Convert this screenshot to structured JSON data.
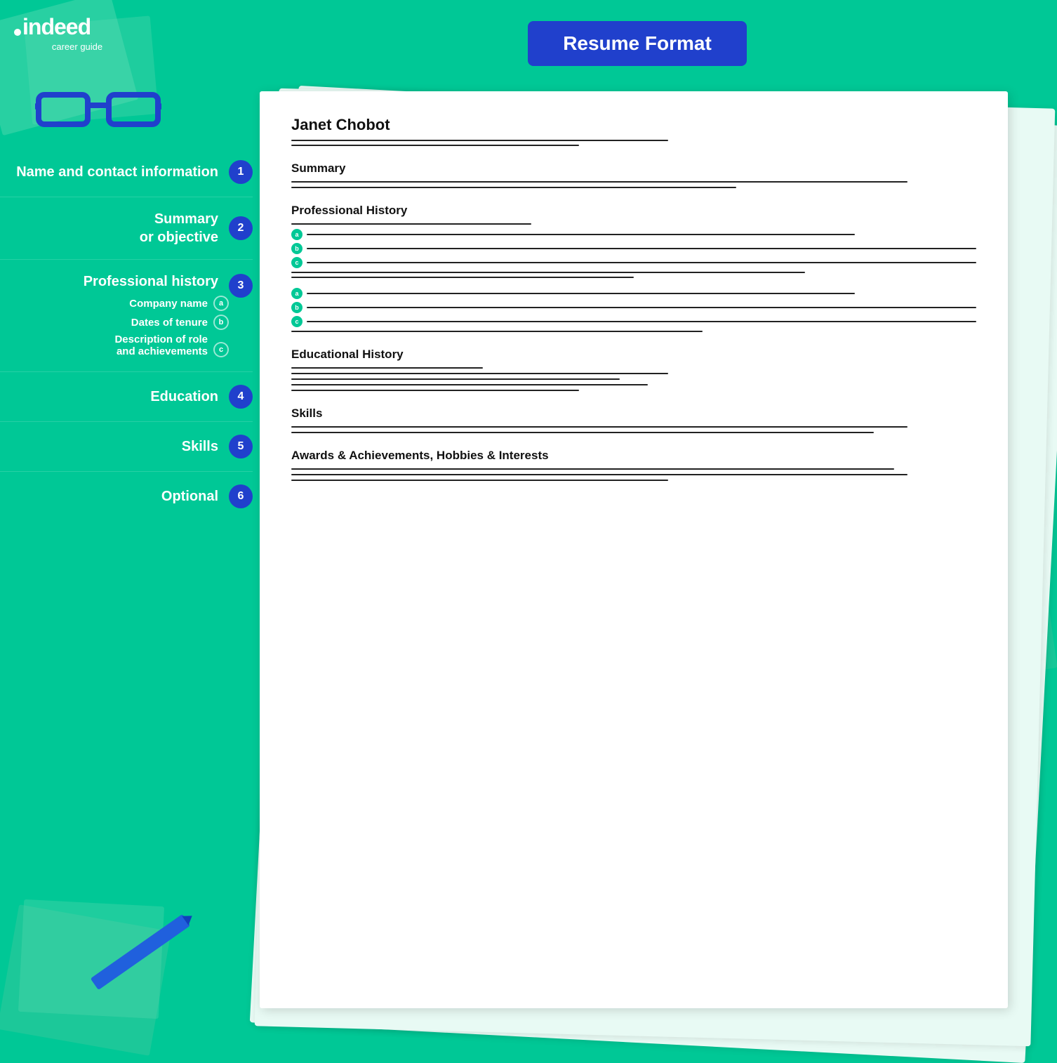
{
  "brand": {
    "name": "indeed",
    "tagline": "career guide",
    "dot": "·"
  },
  "header": {
    "title": "Resume Format"
  },
  "sidebar": {
    "items": [
      {
        "id": 1,
        "label": "Name and contact\ninformation",
        "step": "1",
        "sub_items": []
      },
      {
        "id": 2,
        "label": "Summary\nor objective",
        "step": "2",
        "sub_items": []
      },
      {
        "id": 3,
        "label": "Professional history",
        "step": "3",
        "sub_items": [
          {
            "letter": "a",
            "text": "Company name"
          },
          {
            "letter": "b",
            "text": "Dates of tenure"
          },
          {
            "letter": "c",
            "text": "Description of role\nand achievements"
          }
        ]
      },
      {
        "id": 4,
        "label": "Education",
        "step": "4",
        "sub_items": []
      },
      {
        "id": 5,
        "label": "Skills",
        "step": "5",
        "sub_items": []
      },
      {
        "id": 6,
        "label": "Optional",
        "step": "6",
        "sub_items": []
      }
    ]
  },
  "resume": {
    "name": "Janet Chobot",
    "sections": [
      {
        "id": "summary",
        "title": "Summary"
      },
      {
        "id": "professional",
        "title": "Professional History"
      },
      {
        "id": "education",
        "title": "Educational History"
      },
      {
        "id": "skills",
        "title": "Skills"
      },
      {
        "id": "awards",
        "title": "Awards & Achievements, Hobbies & Interests"
      }
    ]
  },
  "colors": {
    "background": "#00c896",
    "sidebar_badge": "#2040cc",
    "bullet": "#00c896",
    "header_box": "#2040cc",
    "pen": "#2060dd"
  }
}
